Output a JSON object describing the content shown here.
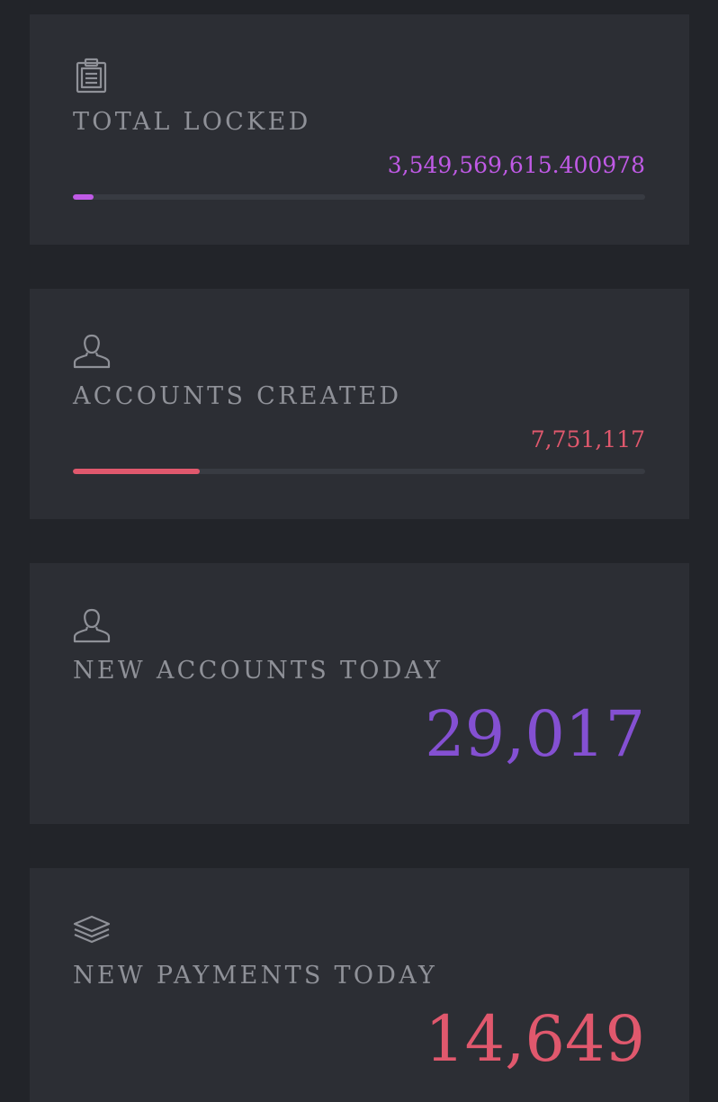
{
  "colors": {
    "page_background": "#222429",
    "card_background": "#2c2e34",
    "title_text": "#8f9198",
    "icon_stroke": "#8f9198",
    "track": "#383b42"
  },
  "cards": [
    {
      "icon": "clipboard-icon",
      "title": "TOTAL LOCKED",
      "value": "3,549,569,615.400978",
      "value_color": "#c05ae6",
      "progress": 0.036,
      "progress_color": "#c05ae6"
    },
    {
      "icon": "user-icon",
      "title": "ACCOUNTS CREATED",
      "value": "7,751,117",
      "value_color": "#e0586d",
      "progress": 0.222,
      "progress_color": "#e0586d"
    },
    {
      "icon": "user-icon",
      "title": "NEW ACCOUNTS TODAY",
      "value": "29,017",
      "value_color": "#8450d2"
    },
    {
      "icon": "layers-icon",
      "title": "NEW PAYMENTS TODAY",
      "value": "14,649",
      "value_color": "#e0586d"
    }
  ]
}
